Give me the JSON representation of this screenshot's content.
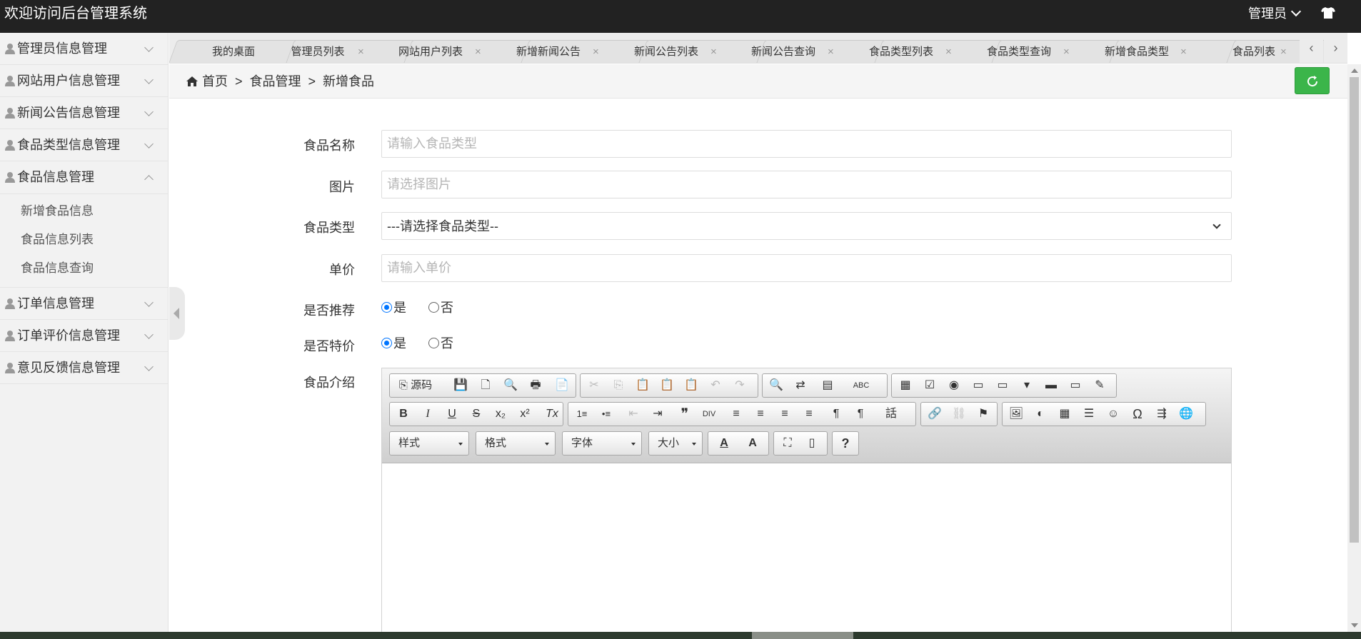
{
  "header": {
    "title": "欢迎访问后台管理系统",
    "user": "管理员"
  },
  "sidebar": {
    "items": [
      {
        "label": "管理员信息管理"
      },
      {
        "label": "网站用户信息管理"
      },
      {
        "label": "新闻公告信息管理"
      },
      {
        "label": "食品类型信息管理"
      },
      {
        "label": "食品信息管理"
      },
      {
        "label": "订单信息管理"
      },
      {
        "label": "订单评价信息管理"
      },
      {
        "label": "意见反馈信息管理"
      }
    ],
    "sub_items": [
      "新增食品信息",
      "食品信息列表",
      "食品信息查询"
    ]
  },
  "tabs": [
    "我的桌面",
    "管理员列表",
    "网站用户列表",
    "新增新闻公告",
    "新闻公告列表",
    "新闻公告查询",
    "食品类型列表",
    "食品类型查询",
    "新增食品类型",
    "食品列表"
  ],
  "tab_close": "×",
  "breadcrumb": {
    "home": "首页",
    "sep": ">",
    "section": "食品管理",
    "current": "新增食品"
  },
  "form": {
    "name_label": "食品名称",
    "name_placeholder": "请输入食品类型",
    "image_label": "图片",
    "image_placeholder": "请选择图片",
    "type_label": "食品类型",
    "type_selected": "---请选择食品类型--",
    "price_label": "单价",
    "price_placeholder": "请输入单价",
    "recommend_label": "是否推荐",
    "special_label": "是否特价",
    "yes": "是",
    "no": "否",
    "intro_label": "食品介绍"
  },
  "editor": {
    "source_label": "源码",
    "combo_style": "样式",
    "combo_format": "格式",
    "combo_font": "字体",
    "combo_size": "大小",
    "row1": [
      "💾",
      "🗋",
      "🔍",
      "🖶",
      "📄",
      "✂",
      "⎘",
      "📋",
      "📋",
      "📋",
      "↶",
      "↷",
      "🔍",
      "⇄",
      "▤",
      "ABC",
      "▦",
      "☑",
      "◉",
      "▭",
      "▭",
      "▾",
      "▬",
      "▭",
      "✎"
    ],
    "row2": [
      "B",
      "I",
      "U",
      "S",
      "x₂",
      "x²",
      "Tx",
      "1≡",
      "•≡",
      "⇤",
      "⇥",
      "❞",
      "DIV",
      "≡",
      "≡",
      "≡",
      "≡",
      "¶",
      "¶",
      "話",
      "🔗",
      "⛓",
      "⚑",
      "🖼",
      "◐",
      "▦",
      "☰",
      "☺",
      "Ω",
      "⇶",
      "🌐"
    ],
    "row3": [
      "⛶",
      "▯",
      "?",
      "A",
      "A"
    ]
  }
}
